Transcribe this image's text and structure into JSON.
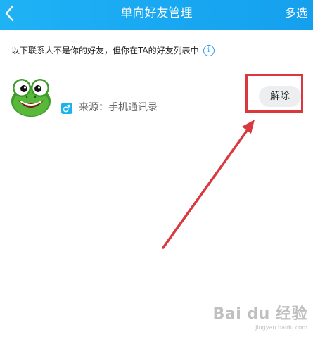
{
  "header": {
    "back_icon": "chevron-left-icon",
    "title": "单向好友管理",
    "multi_select": "多选"
  },
  "notice": {
    "text": "以下联系人不是你的好友，但你在TA的好友列表中",
    "icon": "info-icon",
    "icon_glyph": "i"
  },
  "contact": {
    "avatar_icon": "frog-avatar-icon",
    "gender_icon": "male-icon",
    "source_text": "来源：手机通讯录",
    "remove_label": "解除"
  },
  "annotation": {
    "color": "#d9383e"
  },
  "watermark": {
    "brand": "Bai du 经验",
    "url": "jingyan.baidu.com"
  },
  "colors": {
    "header": "#19a8f2",
    "gender_badge": "#19b3ec",
    "info": "#2b9af3"
  }
}
